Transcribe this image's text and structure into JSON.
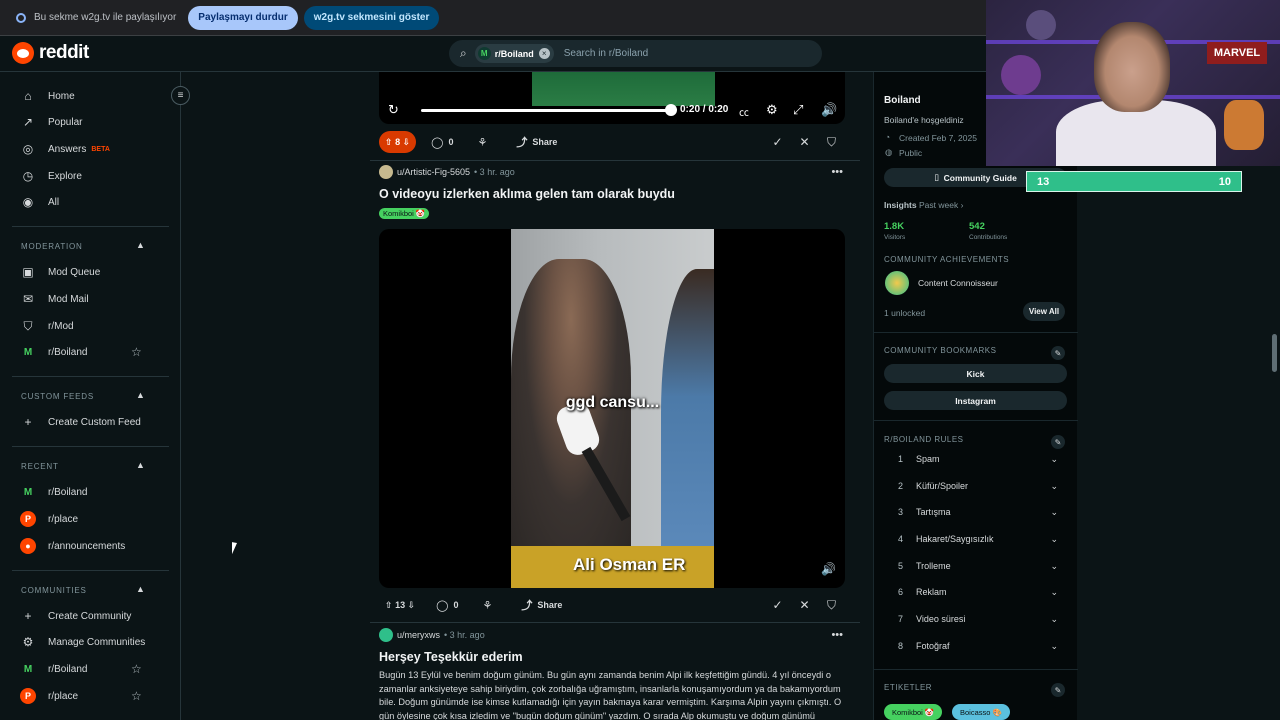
{
  "sharebar": {
    "message": "Bu sekme w2g.tv ile paylaşılıyor",
    "stop_label": "Paylaşmayı durdur",
    "show_label": "w2g.tv sekmesini göster"
  },
  "header": {
    "logo_text": "reddit",
    "search_chip": "r/Boiland",
    "search_placeholder": "Search in r/Boiland"
  },
  "sidebar": {
    "main": [
      {
        "label": "Home",
        "icon": "home-icon",
        "glyph": "⌂"
      },
      {
        "label": "Popular",
        "icon": "popular-icon",
        "glyph": "↗"
      },
      {
        "label": "Answers",
        "icon": "answers-icon",
        "glyph": "◎",
        "badge": "BETA"
      },
      {
        "label": "Explore",
        "icon": "explore-icon",
        "glyph": "◷"
      },
      {
        "label": "All",
        "icon": "all-icon",
        "glyph": "◉"
      }
    ],
    "moderation": {
      "title": "MODERATION",
      "items": [
        "Mod Queue",
        "Mod Mail",
        "r/Mod",
        "r/Boiland"
      ]
    },
    "custom_feeds": {
      "title": "CUSTOM FEEDS",
      "items": [
        "Create Custom Feed"
      ]
    },
    "recent": {
      "title": "RECENT",
      "items": [
        "r/Boiland",
        "r/place",
        "r/announcements"
      ]
    },
    "communities": {
      "title": "COMMUNITIES",
      "items": [
        "Create Community",
        "Manage Communities",
        "r/Boiland",
        "r/place"
      ]
    }
  },
  "video_top": {
    "time": "0:20 / 0:20",
    "progress": 1.0
  },
  "posts": [
    {
      "votes": "8",
      "comments": "0",
      "share": "Share"
    },
    {
      "author": "u/Artistic-Fig-5605",
      "time": "• 3 hr. ago",
      "title": "O videoyu izlerken aklıma gelen tam olarak buydu",
      "flair": "Komikboi 🤡",
      "caption": "ggd cansu...",
      "lower_third": "Ali Osman ER",
      "votes": "13",
      "comments": "0",
      "share": "Share"
    },
    {
      "author": "u/meryxws",
      "time": "• 3 hr. ago",
      "title": "Herşey Teşekkür ederim",
      "body": "Bugün 13 Eylül ve benim doğum günüm. Bu gün aynı zamanda benim Alpi ilk keşfettiğim gündü. 4 yıl önceydi o zamanlar anksiyeteye sahip biriydim, çok zorbalığa uğramıştım, insanlarla konuşamıyordum ya da bakamıyordum bile. Doğum günümde ise kimse kutlamadığı için yayın bakmaya karar vermiştim. Karşıma Alpin yayını çıkmıştı. O gün öylesine çok kısa izledim ve \"bugün doğum günüm\" yazdım. O sırada Alp okumuştu ve doğum günümü"
    }
  ],
  "right": {
    "name": "Boiland",
    "welcome": "Boiland'e hoşgeldiniz",
    "created": "Created Feb 7, 2025",
    "visibility": "Public",
    "guide_btn": "Community Guide",
    "insights": "Insights",
    "period": "Past week ›",
    "visitors_val": "1.8K",
    "visitors_lbl": "Visitors",
    "contrib_val": "542",
    "contrib_lbl": "Contributions",
    "achievements_title": "COMMUNITY ACHIEVEMENTS",
    "achievement": "Content Connoisseur",
    "unlocked": "1 unlocked",
    "view_all": "View All",
    "bookmarks_title": "COMMUNITY BOOKMARKS",
    "bookmarks": [
      "Kick",
      "Instagram"
    ],
    "rules_title": "R/BOILAND RULES",
    "rules": [
      "Spam",
      "Küfür/Spoiler",
      "Tartışma",
      "Hakaret/Saygısızlık",
      "Trolleme",
      "Reklam",
      "Video süresi",
      "Fotoğraf"
    ],
    "tags_title": "ETIKETLER",
    "tags": [
      "Komikboi 🤡",
      "Boicasso 🎨"
    ]
  },
  "overlay": {
    "webcam_poster": "MARVEL",
    "score_left": "13",
    "score_right": "10"
  }
}
